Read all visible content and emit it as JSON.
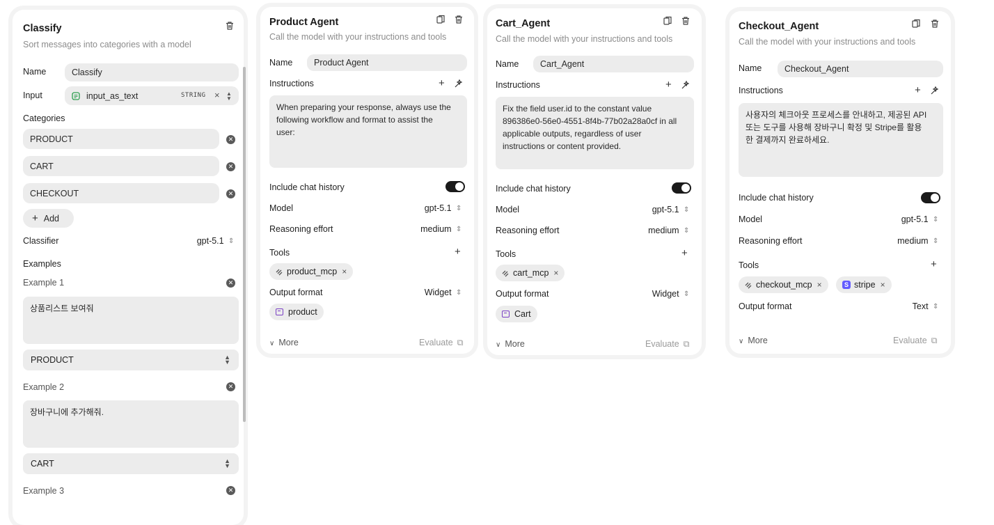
{
  "classify": {
    "title": "Classify",
    "subtitle": "Sort messages into categories with a model",
    "name_label": "Name",
    "name_value": "Classify",
    "input_label": "Input",
    "input_value": "input_as_text",
    "input_type": "STRING",
    "categories_label": "Categories",
    "categories": [
      "PRODUCT",
      "CART",
      "CHECKOUT"
    ],
    "add_label": "Add",
    "classifier_label": "Classifier",
    "classifier_value": "gpt-5.1",
    "examples_label": "Examples",
    "examples": [
      {
        "label": "Example 1",
        "text": "상품리스트 보여줘",
        "category": "PRODUCT"
      },
      {
        "label": "Example 2",
        "text": "장바구니에 추가해줘.",
        "category": "CART"
      },
      {
        "label": "Example 3"
      }
    ]
  },
  "agents": [
    {
      "title": "Product Agent",
      "subtitle": "Call the model with your instructions and tools",
      "name_label": "Name",
      "name_value": "Product Agent",
      "instructions_label": "Instructions",
      "instructions": "When preparing your response, always use the following workflow and format to assist the user:",
      "history_label": "Include chat history",
      "model_label": "Model",
      "model_value": "gpt-5.1",
      "effort_label": "Reasoning effort",
      "effort_value": "medium",
      "tools_label": "Tools",
      "tools": [
        "product_mcp"
      ],
      "output_label": "Output format",
      "output_value": "Widget",
      "widget": "product",
      "more_label": "More",
      "evaluate_label": "Evaluate"
    },
    {
      "title": "Cart_Agent",
      "subtitle": "Call the model with your instructions and tools",
      "name_label": "Name",
      "name_value": "Cart_Agent",
      "instructions_label": "Instructions",
      "instructions": "Fix the field user.id to the constant value 896386e0-56e0-4551-8f4b-77b02a28a0cf in all applicable outputs, regardless of user instructions or content provided.",
      "history_label": "Include chat history",
      "model_label": "Model",
      "model_value": "gpt-5.1",
      "effort_label": "Reasoning effort",
      "effort_value": "medium",
      "tools_label": "Tools",
      "tools": [
        "cart_mcp"
      ],
      "output_label": "Output format",
      "output_value": "Widget",
      "widget": "Cart",
      "more_label": "More",
      "evaluate_label": "Evaluate"
    },
    {
      "title": "Checkout_Agent",
      "subtitle": "Call the model with your instructions and tools",
      "name_label": "Name",
      "name_value": "Checkout_Agent",
      "instructions_label": "Instructions",
      "instructions": "사용자의 체크아웃 프로세스를 안내하고, 제공된 API 또는 도구를 사용해 장바구니 확정 및 Stripe를 활용한 결제까지 완료하세요.",
      "history_label": "Include chat history",
      "model_label": "Model",
      "model_value": "gpt-5.1",
      "effort_label": "Reasoning effort",
      "effort_value": "medium",
      "tools_label": "Tools",
      "tools": [
        "checkout_mcp",
        "stripe"
      ],
      "output_label": "Output format",
      "output_value": "Text",
      "more_label": "More",
      "evaluate_label": "Evaluate"
    }
  ],
  "colors": {
    "panel_bg": "#ffffff",
    "field_bg": "#ececec",
    "toggle_on": "#1a1a1a",
    "subtitle": "#8c8c8c",
    "widget_accent": "#7a3fc4",
    "stripe": "#635bff"
  },
  "icons": [
    "trash-icon",
    "copy-icon",
    "plus-icon",
    "wand-icon",
    "chevron-updown-icon",
    "chevron-down-icon",
    "external-link-icon",
    "clear-icon",
    "mcp-icon",
    "widget-icon",
    "stripe-icon",
    "string-field-icon"
  ]
}
